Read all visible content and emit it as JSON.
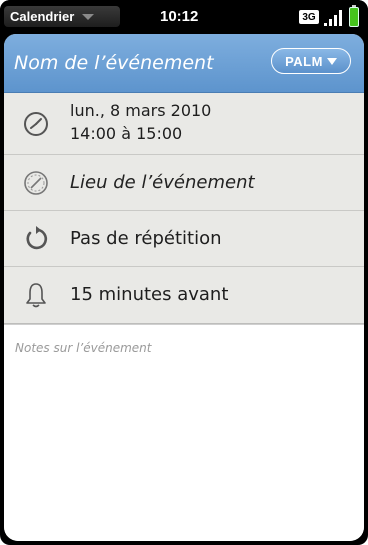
{
  "status_bar": {
    "app_menu_label": "Calendrier",
    "time": "10:12",
    "network": "3G",
    "icons": [
      "chevron-down-icon",
      "signal-icon",
      "battery-icon"
    ]
  },
  "header": {
    "event_name_placeholder": "Nom de l’événement",
    "calendar_button_label": "PALM",
    "colors": {
      "header_bg": "#6fa2d6",
      "battery": "#46c41d"
    }
  },
  "details": {
    "date": "lun., 8 mars 2010",
    "time_range": "14:00 à 15:00",
    "location_placeholder": "Lieu de l’événement",
    "repeat": "Pas de répétition",
    "reminder": "15 minutes avant"
  },
  "notes": {
    "placeholder": "Notes sur l’événement"
  }
}
